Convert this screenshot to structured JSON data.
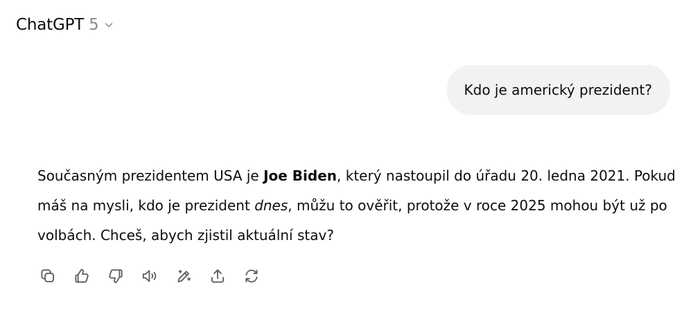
{
  "header": {
    "model_name": "ChatGPT",
    "model_version": "5",
    "dropdown_icon": "chevron-down-icon"
  },
  "user_message": {
    "text": "Kdo je americký prezident?"
  },
  "assistant_message": {
    "segments": [
      {
        "text": "Současným prezidentem USA je ",
        "style": "normal"
      },
      {
        "text": "Joe Biden",
        "style": "bold"
      },
      {
        "text": ", který nastoupil do úřadu 20. ledna 2021. Pokud máš na mysli, kdo je prezident ",
        "style": "normal"
      },
      {
        "text": "dnes",
        "style": "italic"
      },
      {
        "text": ", můžu to ověřit, protože v roce 2025 mohou být už po volbách. Chceš, abych zjistil aktuální stav?",
        "style": "normal"
      }
    ]
  },
  "action_bar": {
    "icons": [
      "copy-icon",
      "thumbs-up-icon",
      "thumbs-down-icon",
      "read-aloud-icon",
      "edit-icon",
      "share-icon",
      "regenerate-icon"
    ]
  },
  "colors": {
    "text": "#0d0d0d",
    "muted": "#8a8a8a",
    "icon": "#5d5d5d",
    "bubble_bg": "#f2f2f2",
    "background": "#ffffff"
  }
}
